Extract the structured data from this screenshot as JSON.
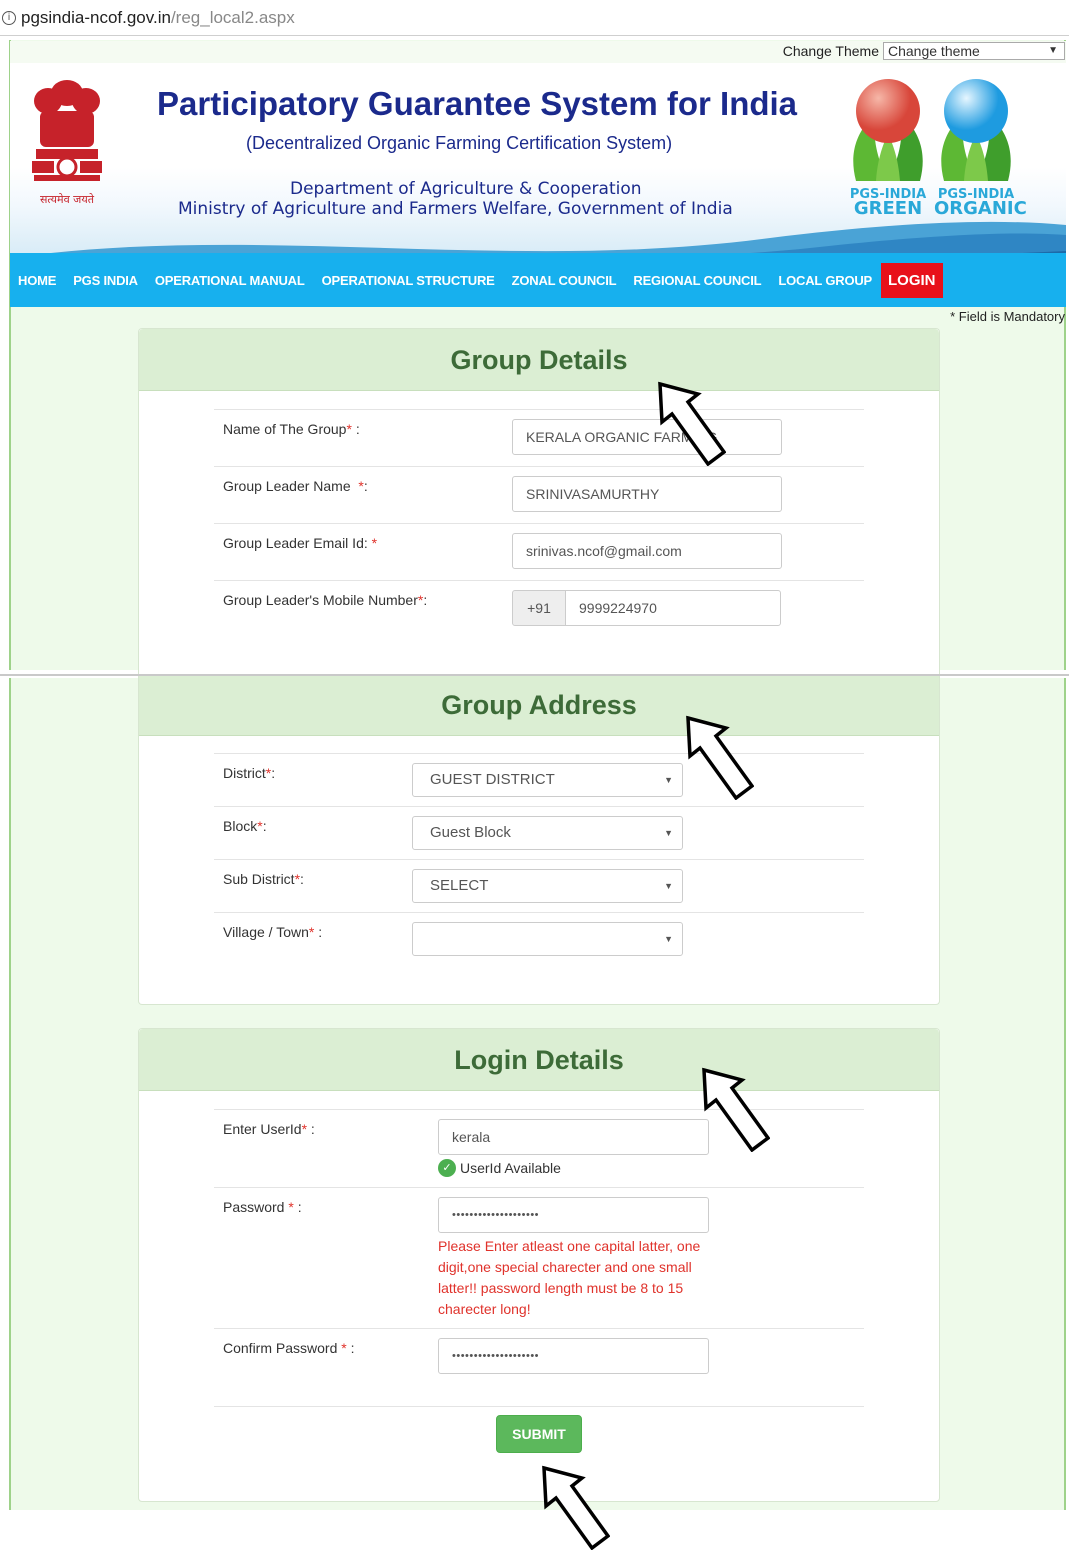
{
  "browser": {
    "url_host": "pgsindia-ncof.gov.in",
    "url_path": "/reg_local2.aspx",
    "info_icon": "info-icon"
  },
  "header": {
    "theme_label": "Change Theme",
    "theme_select": "Change theme",
    "title": "Participatory Guarantee System for India",
    "subtitle": "(Decentralized Organic Farming Certification System)",
    "dept_line1": "Department of Agriculture & Cooperation",
    "dept_line2": "Ministry of Agriculture and Farmers Welfare, Government of India",
    "emblem_motto": "सत्यमेव जयते",
    "logo_green": {
      "line1": "PGS-INDIA",
      "line2": "GREEN"
    },
    "logo_organic": {
      "line1": "PGS-INDIA",
      "line2": "ORGANIC"
    }
  },
  "nav": {
    "items": [
      "HOME",
      "PGS INDIA",
      "OPERATIONAL MANUAL",
      "OPERATIONAL STRUCTURE",
      "ZONAL COUNCIL",
      "REGIONAL COUNCIL",
      "LOCAL GROUP"
    ],
    "login": "LOGIN"
  },
  "mandatory_note": "* Field is Mandatory",
  "group_details": {
    "title": "Group Details",
    "name_label": "Name of The Group",
    "name_suffix": " :",
    "name_value": "KERALA ORGANIC FARMING",
    "leader_label": "Group Leader Name  ",
    "leader_suffix": ":",
    "leader_value": "SRINIVASAMURTHY",
    "email_label": "Group Leader Email Id: ",
    "email_value": "srinivas.ncof@gmail.com",
    "mobile_label": "Group Leader's Mobile Number",
    "mobile_suffix": ":",
    "mobile_prefix": "+91",
    "mobile_value": "9999224970"
  },
  "group_address": {
    "title": "Group Address",
    "district_label": "District",
    "district_value": "GUEST DISTRICT",
    "block_label": "Block",
    "block_value": "Guest Block",
    "subdistrict_label": "Sub District",
    "subdistrict_value": "SELECT",
    "village_label": "Village / Town",
    "village_suffix": " :",
    "village_value": ""
  },
  "login_details": {
    "title": "Login Details",
    "userid_label": "Enter UserId",
    "userid_suffix": " :",
    "userid_value": "kerala",
    "userid_status": "UserId Available",
    "password_label": "Password ",
    "password_suffix": " :",
    "password_value": "••••••••••••••••••••",
    "password_error": "Please Enter atleast one capital latter, one digit,one special charecter and one small latter!! password length must be 8 to 15 charecter long!",
    "confirm_label": "Confirm Password ",
    "confirm_suffix": " :",
    "confirm_value": "••••••••••••••••••••",
    "submit": "SUBMIT"
  },
  "req_mark": "*",
  "colors": {
    "nav_bg": "#17b0ee",
    "login_bg": "#e8101a",
    "panel_head": "#dbeed3",
    "title_blue": "#1b2a8c",
    "submit": "#5cb85c",
    "error": "#e0322b"
  }
}
